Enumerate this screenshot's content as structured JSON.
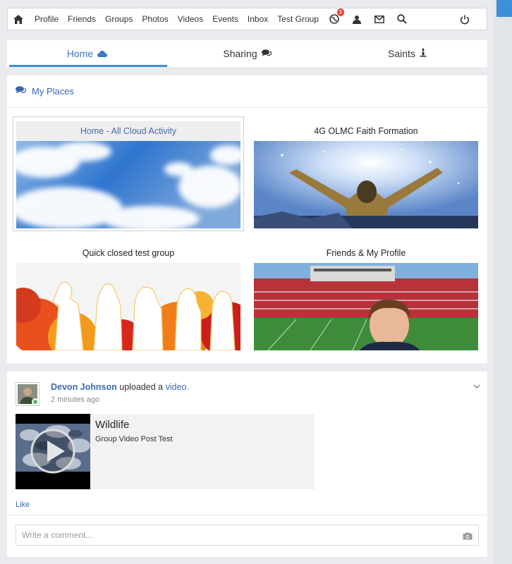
{
  "nav": {
    "items": [
      "Profile",
      "Friends",
      "Groups",
      "Photos",
      "Videos",
      "Events",
      "Inbox",
      "Test Group"
    ],
    "notification_count": "3"
  },
  "tabs": [
    {
      "label": "Home",
      "icon": "cloud-icon",
      "active": true
    },
    {
      "label": "Sharing",
      "icon": "comments-icon",
      "active": false
    },
    {
      "label": "Saints",
      "icon": "candle-icon",
      "active": false
    }
  ],
  "places": {
    "header": "My Places",
    "items": [
      {
        "name": "Home - All Cloud Activity",
        "image": "sky-clouds",
        "selected": true
      },
      {
        "name": "4G OLMC Faith Formation",
        "image": "statue-arms-raised",
        "selected": false
      },
      {
        "name": "Quick closed test group",
        "image": "people-silhouettes",
        "selected": false
      },
      {
        "name": "Friends & My Profile",
        "image": "stadium-boy",
        "selected": false
      }
    ]
  },
  "post": {
    "author": "Devon Johnson",
    "action": "uploaded a",
    "object": "video.",
    "time": "2 minutes ago",
    "video_title": "Wildlife",
    "video_desc": "Group Video Post Test",
    "like": "Like",
    "comment_placeholder": "Write a comment..."
  },
  "colors": {
    "accent": "#3d8fd8",
    "link": "#3a69b0",
    "badge": "#e0433a"
  }
}
